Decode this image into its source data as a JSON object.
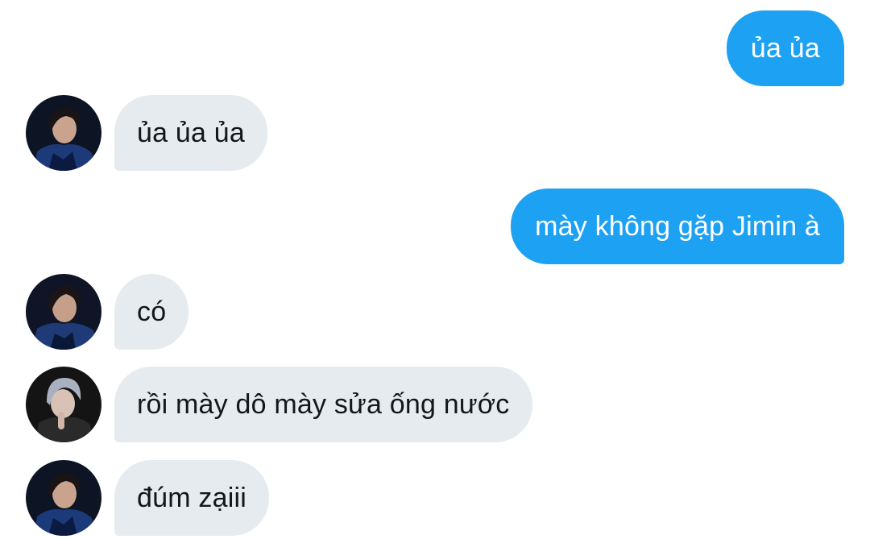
{
  "conversation": {
    "messages": [
      {
        "side": "outgoing",
        "text": "ủa ủa"
      },
      {
        "side": "incoming",
        "text": "ủa ủa ủa",
        "avatar": "profile-photo-dark-hair"
      },
      {
        "side": "outgoing",
        "text": "mày không gặp Jimin à"
      },
      {
        "side": "incoming",
        "text": "có",
        "avatar": "profile-photo-dark-hair"
      },
      {
        "side": "incoming",
        "text": "rồi mày dô mày sửa ống nước",
        "avatar": "profile-photo-silver-hair"
      },
      {
        "side": "incoming",
        "text": "đúm zạiii",
        "avatar": "profile-photo-dark-hair"
      }
    ]
  },
  "colors": {
    "outgoing_bubble": "#1da1f2",
    "incoming_bubble": "#e6ebef",
    "incoming_text": "#14171a",
    "outgoing_text": "#ffffff"
  }
}
